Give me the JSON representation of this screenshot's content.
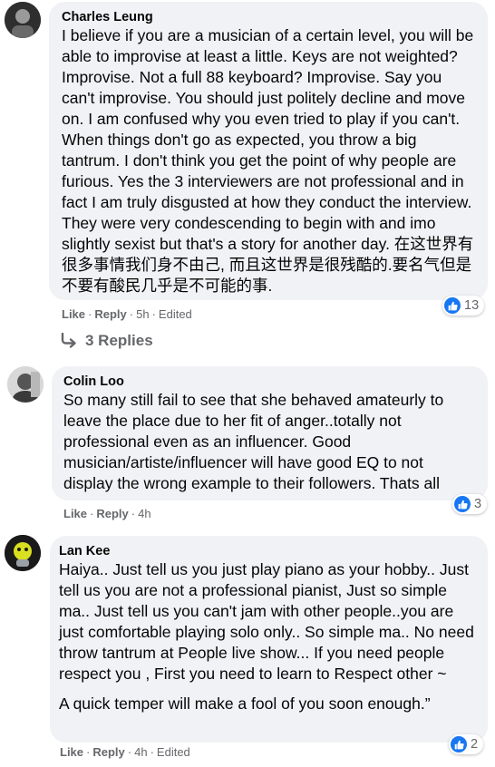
{
  "comments": [
    {
      "author": "Charles Leung",
      "text": "I believe if you are a musician of a certain level, you will be able to improvise at least a little. Keys are not weighted? Improvise. Not a full 88 keyboard? Improvise. Say you can't improvise. You should just politely decline and move on. I am confused why you even tried to play if you can't. When things don't go as expected, you throw a big tantrum. I don't think you get the point of why people are furious. Yes the 3 interviewers are not professional and in fact I am truly disgusted at how they conduct the interview. They were very condescending to begin with and imo slightly sexist but that's a story for another day. 在这世界有很多事情我们身不由己, 而且这世界是很残酷的.要名气但是不要有酸民几乎是不可能的事.",
      "like_label": "Like",
      "reply_label": "Reply",
      "time": "5h",
      "edited": "Edited",
      "reaction_count": "13",
      "replies_label": "3 Replies"
    },
    {
      "author": "Colin Loo",
      "text": "So many still fail to see that she behaved amateurly to leave the place due to her fit of anger..totally not professional even as an influencer. Good musician/artiste/influencer will have good EQ to not display the wrong example to their followers. Thats all",
      "like_label": "Like",
      "reply_label": "Reply",
      "time": "4h",
      "reaction_count": "3"
    },
    {
      "author": "Lan Kee",
      "text": "Haiya.. Just tell us you just play piano as your hobby.. Just tell us you are not a professional pianist, Just so simple ma.. Just tell us you can't jam with other people..you are just comfortable playing solo only.. So simple ma.. No need throw tantrum at People live show... If you need people respect you , First you need to learn to Respect other ~",
      "text2": "A quick temper will make a fool of you soon enough.”",
      "like_label": "Like",
      "reply_label": "Reply",
      "time": "4h",
      "edited": "Edited",
      "reaction_count": "2"
    }
  ],
  "colors": {
    "bubble": "#f0f2f5",
    "meta_text": "#65676b",
    "like_blue": "#1877f2"
  }
}
